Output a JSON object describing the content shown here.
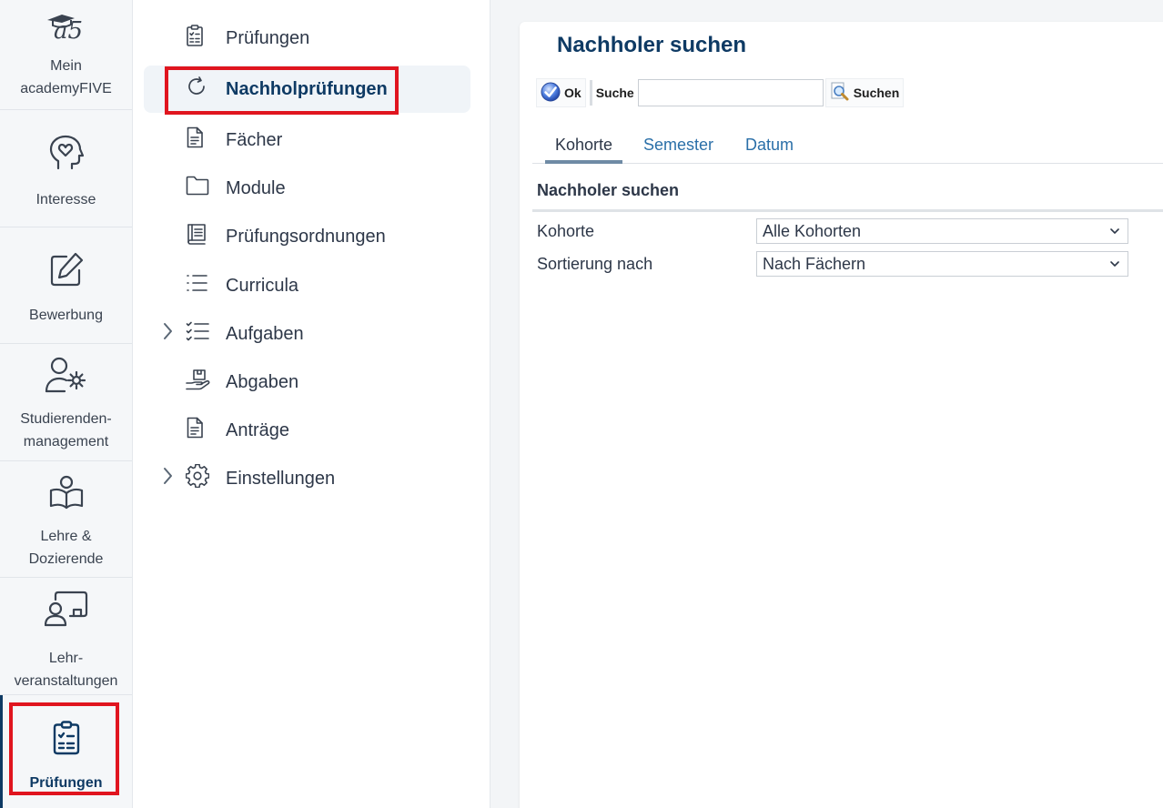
{
  "rail": {
    "items": [
      {
        "label_line1": "Mein",
        "label_line2": "academyFIVE",
        "icon": "a5-logo-icon"
      },
      {
        "label_line1": "Interesse",
        "label_line2": "",
        "icon": "head-heart-icon"
      },
      {
        "label_line1": "Bewerbung",
        "label_line2": "",
        "icon": "edit-icon"
      },
      {
        "label_line1": "Studierenden-",
        "label_line2": "management",
        "icon": "user-gear-icon"
      },
      {
        "label_line1": "Lehre &",
        "label_line2": "Dozierende",
        "icon": "reader-icon"
      },
      {
        "label_line1": "Lehr-",
        "label_line2": "veranstaltungen",
        "icon": "presentation-icon"
      },
      {
        "label_line1": "Prüfungen",
        "label_line2": "",
        "icon": "clipboard-check-icon"
      }
    ],
    "logo_text": "a5"
  },
  "subnav": {
    "items": [
      {
        "label": "Prüfungen",
        "icon": "clipboard-icon"
      },
      {
        "label": "Nachholprüfungen",
        "icon": "refresh-icon"
      },
      {
        "label": "Fächer",
        "icon": "document-icon"
      },
      {
        "label": "Module",
        "icon": "folder-icon"
      },
      {
        "label": "Prüfungsordnungen",
        "icon": "book-icon"
      },
      {
        "label": "Curricula",
        "icon": "list-icon"
      },
      {
        "label": "Aufgaben",
        "icon": "checklist-icon"
      },
      {
        "label": "Abgaben",
        "icon": "hand-box-icon"
      },
      {
        "label": "Anträge",
        "icon": "document-icon"
      },
      {
        "label": "Einstellungen",
        "icon": "gear-icon"
      }
    ]
  },
  "main": {
    "title": "Nachholer suchen",
    "toolbar": {
      "ok_label": "Ok",
      "search_label": "Suche",
      "search_value": "",
      "search_button_label": "Suchen"
    },
    "tabs": [
      {
        "label": "Kohorte"
      },
      {
        "label": "Semester"
      },
      {
        "label": "Datum"
      }
    ],
    "section_title": "Nachholer suchen",
    "form": {
      "kohorte_label": "Kohorte",
      "kohorte_value": "Alle Kohorten",
      "sort_label": "Sortierung nach",
      "sort_value": "Nach Fächern"
    }
  },
  "colors": {
    "brand": "#0e3a64",
    "highlight": "#e0151f",
    "link": "#2a6fa8"
  }
}
